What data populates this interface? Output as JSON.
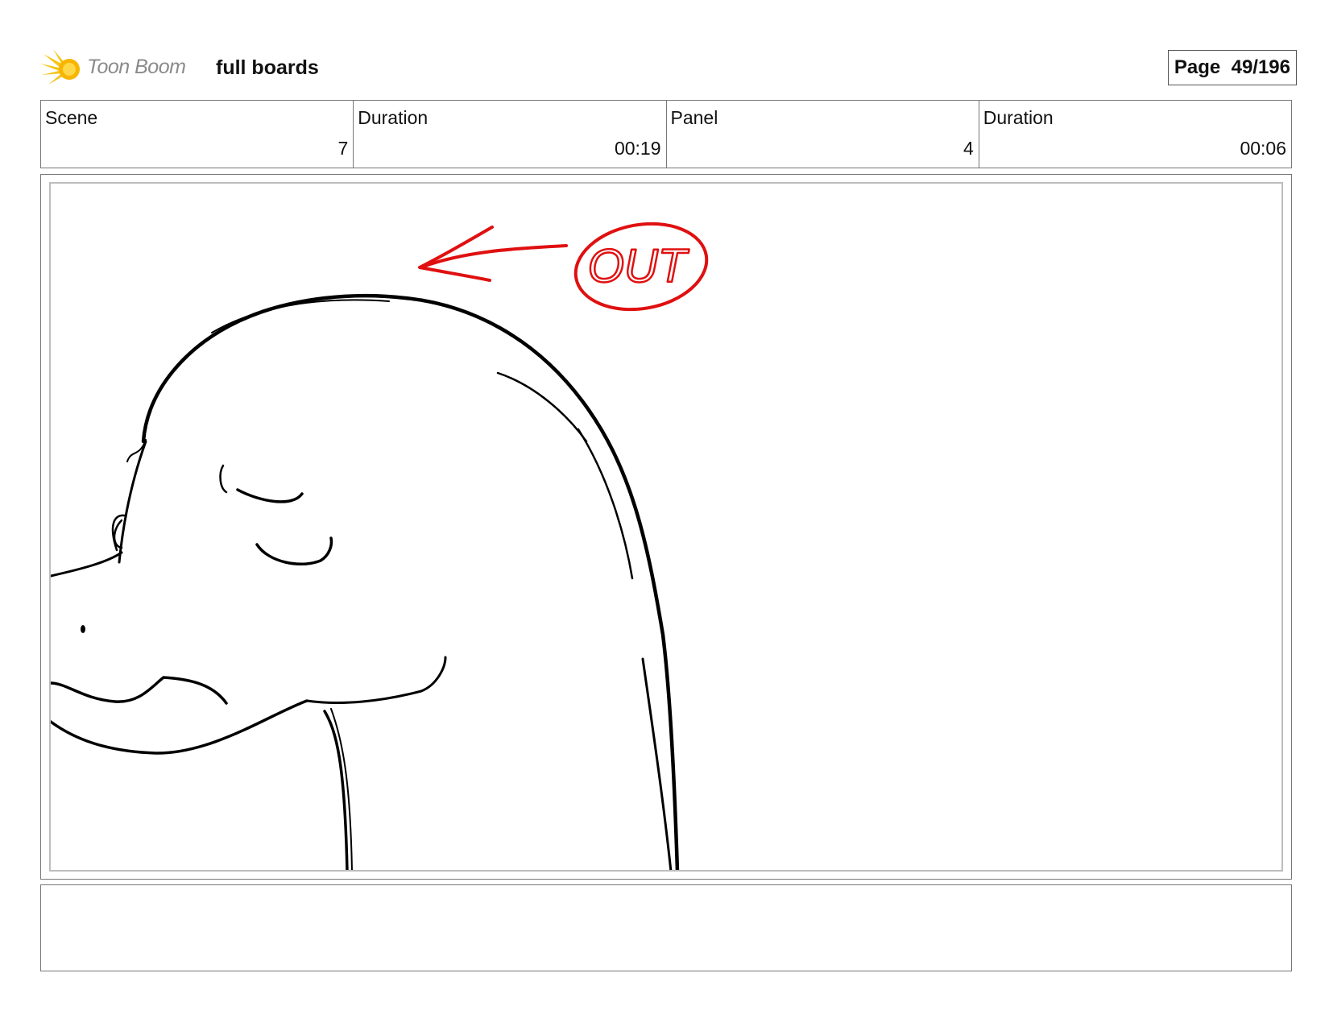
{
  "header": {
    "logo_text": "Toon Boom",
    "project_title": "full boards",
    "page_label": "Page",
    "page_number": "49/196"
  },
  "info": {
    "cells": [
      {
        "label": "Scene",
        "value": "7"
      },
      {
        "label": "Duration",
        "value": "00:19"
      },
      {
        "label": "Panel",
        "value": "4"
      },
      {
        "label": "Duration",
        "value": "00:06"
      }
    ]
  },
  "panel": {
    "annotation_text": "OUT",
    "annotation_color": "#e01010",
    "line_color": "#000000"
  },
  "notes": {
    "text": ""
  }
}
